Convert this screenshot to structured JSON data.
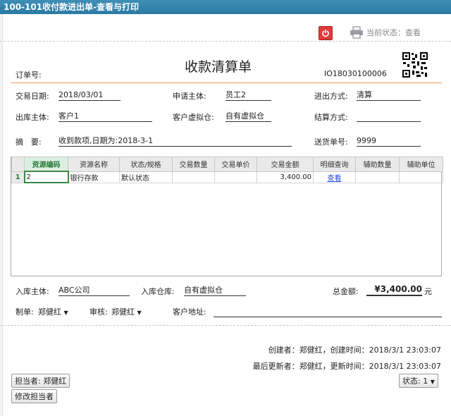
{
  "window": {
    "title": "100-101收付款进出单-查看与打印"
  },
  "toolbar": {
    "status_label": "当前状态：查看"
  },
  "doc": {
    "title": "收款清算单",
    "order_label": "订单号:",
    "order_no": "IO18030100006"
  },
  "fields": {
    "trade_date_label": "交易日期:",
    "trade_date": "2018/03/01",
    "applicant_label": "申请主体:",
    "applicant": "员工2",
    "inout_label": "进出方式:",
    "inout": "清算",
    "out_entity_label": "出库主体:",
    "out_entity": "客户1",
    "customer_wh_label": "客户虚拟仓:",
    "customer_wh": "自有虚拟仓",
    "settle_label": "结算方式:",
    "settle": "",
    "summary_label": "摘　要:",
    "summary": "收到款项,日期为:2018-3-1",
    "delivery_label": "送货单号:",
    "delivery": "9999"
  },
  "grid": {
    "headers": [
      "资源编码",
      "资源名称",
      "状态/规格",
      "交易数量",
      "交易单价",
      "交易金额",
      "明细查询",
      "辅助数量",
      "辅助单位"
    ],
    "rows": [
      {
        "index": "1",
        "code": "2",
        "name": "银行存款",
        "spec": "默认状态",
        "qty": "",
        "price": "",
        "amount": "3,400.00",
        "detail": "查看",
        "aux_qty": "",
        "aux_unit": ""
      }
    ]
  },
  "footer": {
    "in_entity_label": "入库主体:",
    "in_entity": "ABC公司",
    "in_wh_label": "入库仓库:",
    "in_wh": "自有虚拟仓",
    "total_label": "总金额:",
    "total": "¥3,400.00",
    "total_unit": "元",
    "maker_label": "制单:",
    "maker": "郑健红",
    "reviewer_label": "审核:",
    "reviewer": "郑健红",
    "address_label": "客户地址:",
    "address": ""
  },
  "meta": {
    "creator": "创建者：郑健红，创建时间：2018/3/1 23:03:07",
    "updater": "最后更新者：郑健红，更新时间：2018/3/1 23:03:07"
  },
  "buttons": {
    "owner": "担当者: 郑健红",
    "change_owner": "修改担当者",
    "status": "状态: 1"
  }
}
